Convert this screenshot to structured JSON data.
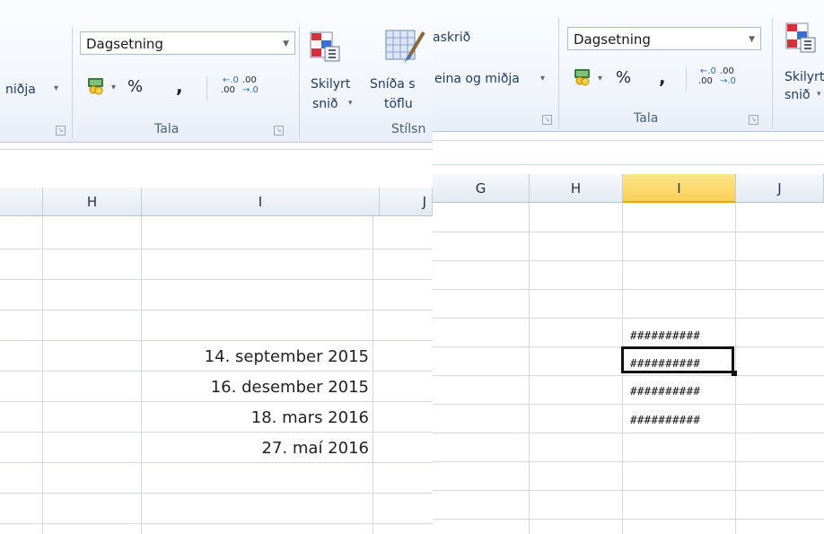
{
  "left": {
    "ribbon": {
      "cut_align_label": "niðja",
      "number_format": "Dagsetning",
      "percent": "%",
      "comma": ",",
      "increase_decimal": ".00",
      "decrease_decimal": ".00",
      "group_number": "Tala",
      "cond_format_line1": "Skilyrt",
      "cond_format_line2": "snið",
      "format_table_line1": "Sníða s",
      "format_table_line2": "töflu",
      "group_styles": "Stílsn"
    },
    "columns": [
      "H",
      "I",
      "J"
    ],
    "cells": [
      "14. september 2015",
      "16. desember 2015",
      "18. mars 2016",
      "27. maí 2016"
    ]
  },
  "right": {
    "ribbon": {
      "wrap_label": "askrið",
      "merge_label": "eina og miðja",
      "number_format": "Dagsetning",
      "percent": "%",
      "comma": ",",
      "increase_decimal": ".00",
      "decrease_decimal": ".00",
      "group_number": "Tala",
      "cond_format_line1": "Skilyrt",
      "cond_format_line2": "snið"
    },
    "columns": [
      "G",
      "H",
      "I",
      "J"
    ],
    "cells": [
      "##########",
      "##########",
      "##########",
      "##########"
    ]
  },
  "icons": {
    "currency": "currency-icon",
    "cond_format": "conditional-format-icon",
    "format_table": "format-table-icon",
    "dialog_launcher": "dialog-launcher-icon"
  },
  "colors": {
    "selected_header": "#f9cf55",
    "grid": "#d4d8de",
    "ribbon_text": "#1f3a5f"
  }
}
